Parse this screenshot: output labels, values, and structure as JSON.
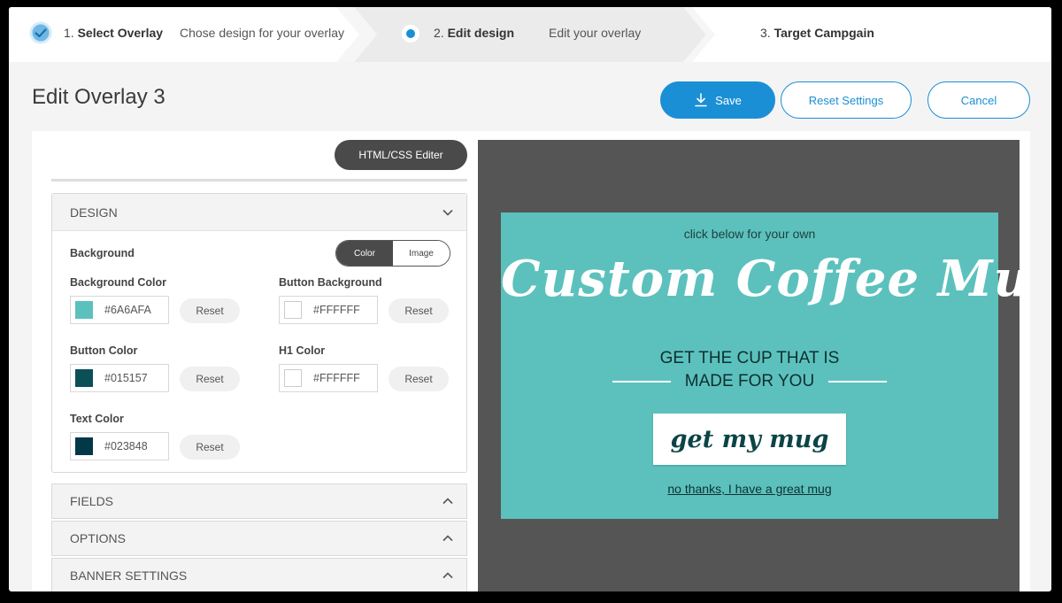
{
  "stepper": {
    "steps": [
      {
        "number": "1.",
        "title": "Select Overlay",
        "description": "Chose design for your overlay",
        "state": "completed"
      },
      {
        "number": "2.",
        "title": "Edit design",
        "description": "Edit your overlay",
        "state": "active"
      },
      {
        "number": "3.",
        "title": "Target Campgain",
        "description": "",
        "state": "pending"
      }
    ]
  },
  "header": {
    "title": "Edit Overlay 3",
    "save_label": "Save",
    "reset_label": "Reset Settings",
    "cancel_label": "Cancel"
  },
  "editor": {
    "html_css_button": "HTML/CSS  Editer",
    "design": {
      "title": "DESIGN",
      "background_label": "Background",
      "toggle": {
        "color": "Color",
        "image": "Image",
        "selected": "Color"
      },
      "fields": {
        "background_color": {
          "label": "Background Color",
          "value": "#6A6AFA",
          "swatch": "#5cc1bd",
          "reset": "Reset"
        },
        "button_background": {
          "label": "Button Background",
          "value": "#FFFFFF",
          "swatch": "#ffffff",
          "reset": "Reset"
        },
        "button_color": {
          "label": "Button Color",
          "value": "#015157",
          "swatch": "#0b4f57",
          "reset": "Reset"
        },
        "h1_color": {
          "label": "H1 Color",
          "value": "#FFFFFF",
          "swatch": "#ffffff",
          "reset": "Reset"
        },
        "text_color": {
          "label": "Text Color",
          "value": "#023848",
          "swatch": "#023848",
          "reset": "Reset"
        }
      }
    },
    "sections": [
      "FIELDS",
      "OPTIONS",
      "BANNER SETTINGS"
    ]
  },
  "preview": {
    "small_text": "click below for your own",
    "headline": "Custom Coffee Mug",
    "subline_1": "GET THE CUP THAT IS",
    "subline_2": "MADE FOR YOU",
    "cta": "get my mug",
    "decline": "no thanks, I have a great mug",
    "background": "#5cc1bd"
  },
  "colors": {
    "accent": "#1a8fd6",
    "dark_button": "#4a4a4a",
    "preview_bg": "#555555"
  }
}
